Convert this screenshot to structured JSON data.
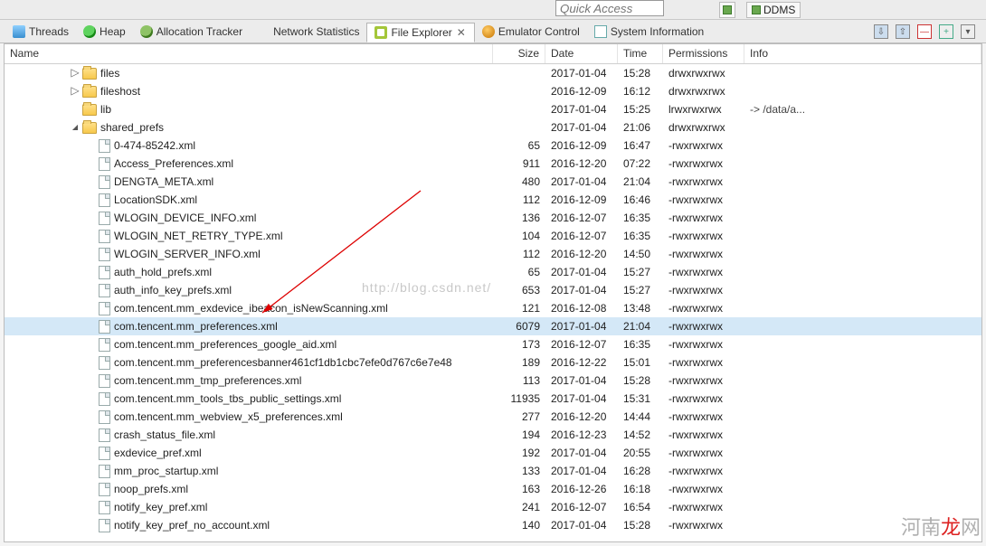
{
  "topbar": {
    "quick_access_placeholder": "Quick Access",
    "perspective_label": "DDMS"
  },
  "tabs": [
    {
      "id": "threads",
      "label": "Threads"
    },
    {
      "id": "heap",
      "label": "Heap"
    },
    {
      "id": "alloc",
      "label": "Allocation Tracker"
    },
    {
      "id": "net",
      "label": "Network Statistics"
    },
    {
      "id": "file",
      "label": "File Explorer",
      "active": true
    },
    {
      "id": "emu",
      "label": "Emulator Control"
    },
    {
      "id": "sys",
      "label": "System Information"
    }
  ],
  "columns": {
    "name": "Name",
    "size": "Size",
    "date": "Date",
    "time": "Time",
    "perm": "Permissions",
    "info": "Info"
  },
  "watermark": "http://blog.csdn.net/",
  "brand_prefix": "河南",
  "brand_red": "龙",
  "brand_suffix": "网",
  "rows": [
    {
      "type": "dir",
      "depth": 4,
      "expander": "right",
      "name": "files",
      "date": "2017-01-04",
      "time": "15:28",
      "perm": "drwxrwxrwx"
    },
    {
      "type": "dir",
      "depth": 4,
      "expander": "right",
      "name": "fileshost",
      "date": "2016-12-09",
      "time": "16:12",
      "perm": "drwxrwxrwx"
    },
    {
      "type": "dir",
      "depth": 4,
      "expander": "none",
      "name": "lib",
      "date": "2017-01-04",
      "time": "15:25",
      "perm": "lrwxrwxrwx",
      "info": "-> /data/a..."
    },
    {
      "type": "dir",
      "depth": 4,
      "expander": "down",
      "name": "shared_prefs",
      "date": "2017-01-04",
      "time": "21:06",
      "perm": "drwxrwxrwx"
    },
    {
      "type": "file",
      "depth": 5,
      "name": "0-474-85242.xml",
      "size": "65",
      "date": "2016-12-09",
      "time": "16:47",
      "perm": "-rwxrwxrwx"
    },
    {
      "type": "file",
      "depth": 5,
      "name": "Access_Preferences.xml",
      "size": "911",
      "date": "2016-12-20",
      "time": "07:22",
      "perm": "-rwxrwxrwx"
    },
    {
      "type": "file",
      "depth": 5,
      "name": "DENGTA_META.xml",
      "size": "480",
      "date": "2017-01-04",
      "time": "21:04",
      "perm": "-rwxrwxrwx"
    },
    {
      "type": "file",
      "depth": 5,
      "name": "LocationSDK.xml",
      "size": "112",
      "date": "2016-12-09",
      "time": "16:46",
      "perm": "-rwxrwxrwx"
    },
    {
      "type": "file",
      "depth": 5,
      "name": "WLOGIN_DEVICE_INFO.xml",
      "size": "136",
      "date": "2016-12-07",
      "time": "16:35",
      "perm": "-rwxrwxrwx"
    },
    {
      "type": "file",
      "depth": 5,
      "name": "WLOGIN_NET_RETRY_TYPE.xml",
      "size": "104",
      "date": "2016-12-07",
      "time": "16:35",
      "perm": "-rwxrwxrwx"
    },
    {
      "type": "file",
      "depth": 5,
      "name": "WLOGIN_SERVER_INFO.xml",
      "size": "112",
      "date": "2016-12-20",
      "time": "14:50",
      "perm": "-rwxrwxrwx"
    },
    {
      "type": "file",
      "depth": 5,
      "name": "auth_hold_prefs.xml",
      "size": "65",
      "date": "2017-01-04",
      "time": "15:27",
      "perm": "-rwxrwxrwx"
    },
    {
      "type": "file",
      "depth": 5,
      "name": "auth_info_key_prefs.xml",
      "size": "653",
      "date": "2017-01-04",
      "time": "15:27",
      "perm": "-rwxrwxrwx"
    },
    {
      "type": "file",
      "depth": 5,
      "name": "com.tencent.mm_exdevice_ibeacon_isNewScanning.xml",
      "size": "121",
      "date": "2016-12-08",
      "time": "13:48",
      "perm": "-rwxrwxrwx"
    },
    {
      "type": "file",
      "depth": 5,
      "name": "com.tencent.mm_preferences.xml",
      "size": "6079",
      "date": "2017-01-04",
      "time": "21:04",
      "perm": "-rwxrwxrwx",
      "selected": true
    },
    {
      "type": "file",
      "depth": 5,
      "name": "com.tencent.mm_preferences_google_aid.xml",
      "size": "173",
      "date": "2016-12-07",
      "time": "16:35",
      "perm": "-rwxrwxrwx"
    },
    {
      "type": "file",
      "depth": 5,
      "name": "com.tencent.mm_preferencesbanner461cf1db1cbc7efe0d767c6e7e48",
      "size": "189",
      "date": "2016-12-22",
      "time": "15:01",
      "perm": "-rwxrwxrwx"
    },
    {
      "type": "file",
      "depth": 5,
      "name": "com.tencent.mm_tmp_preferences.xml",
      "size": "113",
      "date": "2017-01-04",
      "time": "15:28",
      "perm": "-rwxrwxrwx"
    },
    {
      "type": "file",
      "depth": 5,
      "name": "com.tencent.mm_tools_tbs_public_settings.xml",
      "size": "11935",
      "date": "2017-01-04",
      "time": "15:31",
      "perm": "-rwxrwxrwx"
    },
    {
      "type": "file",
      "depth": 5,
      "name": "com.tencent.mm_webview_x5_preferences.xml",
      "size": "277",
      "date": "2016-12-20",
      "time": "14:44",
      "perm": "-rwxrwxrwx"
    },
    {
      "type": "file",
      "depth": 5,
      "name": "crash_status_file.xml",
      "size": "194",
      "date": "2016-12-23",
      "time": "14:52",
      "perm": "-rwxrwxrwx"
    },
    {
      "type": "file",
      "depth": 5,
      "name": "exdevice_pref.xml",
      "size": "192",
      "date": "2017-01-04",
      "time": "20:55",
      "perm": "-rwxrwxrwx"
    },
    {
      "type": "file",
      "depth": 5,
      "name": "mm_proc_startup.xml",
      "size": "133",
      "date": "2017-01-04",
      "time": "16:28",
      "perm": "-rwxrwxrwx"
    },
    {
      "type": "file",
      "depth": 5,
      "name": "noop_prefs.xml",
      "size": "163",
      "date": "2016-12-26",
      "time": "16:18",
      "perm": "-rwxrwxrwx"
    },
    {
      "type": "file",
      "depth": 5,
      "name": "notify_key_pref.xml",
      "size": "241",
      "date": "2016-12-07",
      "time": "16:54",
      "perm": "-rwxrwxrwx"
    },
    {
      "type": "file",
      "depth": 5,
      "name": "notify_key_pref_no_account.xml",
      "size": "140",
      "date": "2017-01-04",
      "time": "15:28",
      "perm": "-rwxrwxrwx"
    }
  ]
}
